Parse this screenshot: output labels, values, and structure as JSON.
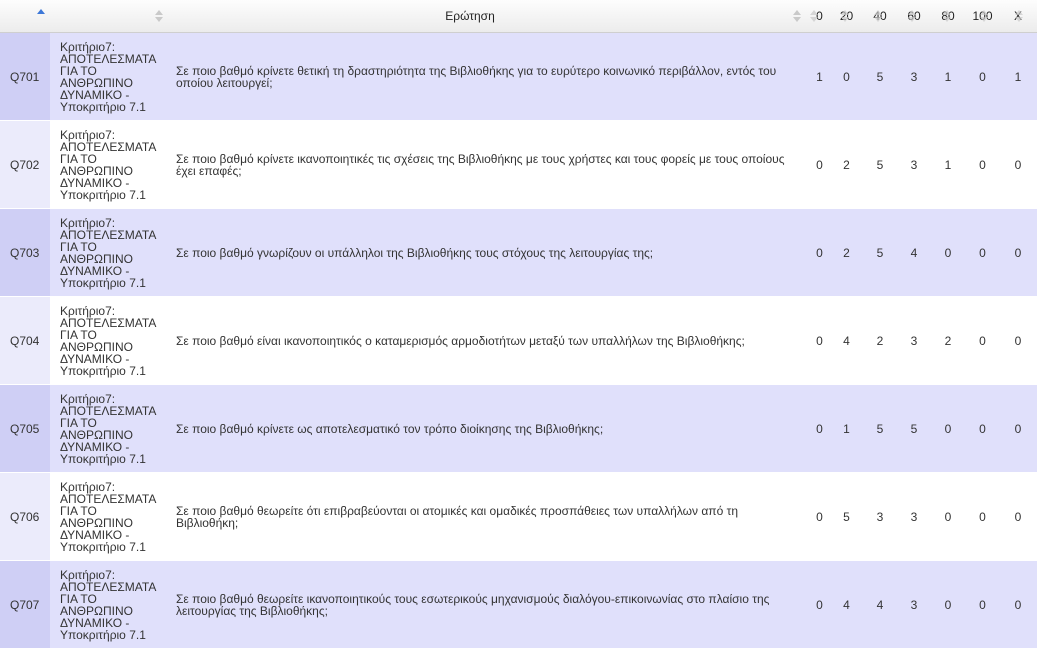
{
  "header": {
    "question_label": "Ερώτηση",
    "cols": [
      "0",
      "20",
      "40",
      "60",
      "80",
      "100",
      "X"
    ]
  },
  "rows": [
    {
      "id": "Q701",
      "criterion": "Κριτήριο7:\nΑΠΟΤΕΛΕΣΜΑΤΑ\nΓΙΑ ΤΟ\nΑΝΘΡΩΠΙΝΟ\nΔΥΝΑΜΙΚΟ -\nΥποκριτήριο 7.1",
      "question": "Σε ποιο βαθμό κρίνετε θετική τη δραστηριότητα της Βιβλιοθήκης για το ευρύτερο κοινωνικό περιβάλλον, εντός του οποίου λειτουργεί;",
      "values": [
        "1",
        "0",
        "5",
        "3",
        "1",
        "0",
        "1"
      ]
    },
    {
      "id": "Q702",
      "criterion": "Κριτήριο7:\nΑΠΟΤΕΛΕΣΜΑΤΑ\nΓΙΑ ΤΟ\nΑΝΘΡΩΠΙΝΟ\nΔΥΝΑΜΙΚΟ -\nΥποκριτήριο 7.1",
      "question": "Σε ποιο βαθμό κρίνετε ικανοποιητικές τις σχέσεις της Βιβλιοθήκης με τους χρήστες και τους φορείς με τους οποίους έχει επαφές;",
      "values": [
        "0",
        "2",
        "5",
        "3",
        "1",
        "0",
        "0"
      ]
    },
    {
      "id": "Q703",
      "criterion": "Κριτήριο7:\nΑΠΟΤΕΛΕΣΜΑΤΑ\nΓΙΑ ΤΟ\nΑΝΘΡΩΠΙΝΟ\nΔΥΝΑΜΙΚΟ -\nΥποκριτήριο 7.1",
      "question": "Σε ποιο βαθμό γνωρίζουν οι υπάλληλοι της Βιβλιοθήκης τους στόχους της λειτουργίας της;",
      "values": [
        "0",
        "2",
        "5",
        "4",
        "0",
        "0",
        "0"
      ]
    },
    {
      "id": "Q704",
      "criterion": "Κριτήριο7:\nΑΠΟΤΕΛΕΣΜΑΤΑ\nΓΙΑ ΤΟ\nΑΝΘΡΩΠΙΝΟ\nΔΥΝΑΜΙΚΟ -\nΥποκριτήριο 7.1",
      "question": "Σε ποιο βαθμό είναι ικανοποιητικός ο καταμερισμός αρμοδιοτήτων μεταξύ των υπαλλήλων της Βιβλιοθήκης;",
      "values": [
        "0",
        "4",
        "2",
        "3",
        "2",
        "0",
        "0"
      ]
    },
    {
      "id": "Q705",
      "criterion": "Κριτήριο7:\nΑΠΟΤΕΛΕΣΜΑΤΑ\nΓΙΑ ΤΟ\nΑΝΘΡΩΠΙΝΟ\nΔΥΝΑΜΙΚΟ -\nΥποκριτήριο 7.1",
      "question": "Σε ποιο βαθμό κρίνετε ως αποτελεσματικό τον τρόπο διοίκησης της Βιβλιοθήκης;",
      "values": [
        "0",
        "1",
        "5",
        "5",
        "0",
        "0",
        "0"
      ]
    },
    {
      "id": "Q706",
      "criterion": "Κριτήριο7:\nΑΠΟΤΕΛΕΣΜΑΤΑ\nΓΙΑ ΤΟ\nΑΝΘΡΩΠΙΝΟ\nΔΥΝΑΜΙΚΟ -\nΥποκριτήριο 7.1",
      "question": "Σε ποιο βαθμό θεωρείτε ότι επιβραβεύονται οι ατομικές και ομαδικές προσπάθειες των υπαλλήλων από τη Βιβλιοθήκη;",
      "values": [
        "0",
        "5",
        "3",
        "3",
        "0",
        "0",
        "0"
      ]
    },
    {
      "id": "Q707",
      "criterion": "Κριτήριο7:\nΑΠΟΤΕΛΕΣΜΑΤΑ\nΓΙΑ ΤΟ\nΑΝΘΡΩΠΙΝΟ\nΔΥΝΑΜΙΚΟ -\nΥποκριτήριο 7.1",
      "question": "Σε ποιο βαθμό θεωρείτε ικανοποιητικούς τους εσωτερικούς μηχανισμούς διαλόγου-επικοινωνίας στο πλαίσιο της λειτουργίας της Βιβλιοθήκης;",
      "values": [
        "0",
        "4",
        "4",
        "3",
        "0",
        "0",
        "0"
      ]
    }
  ]
}
